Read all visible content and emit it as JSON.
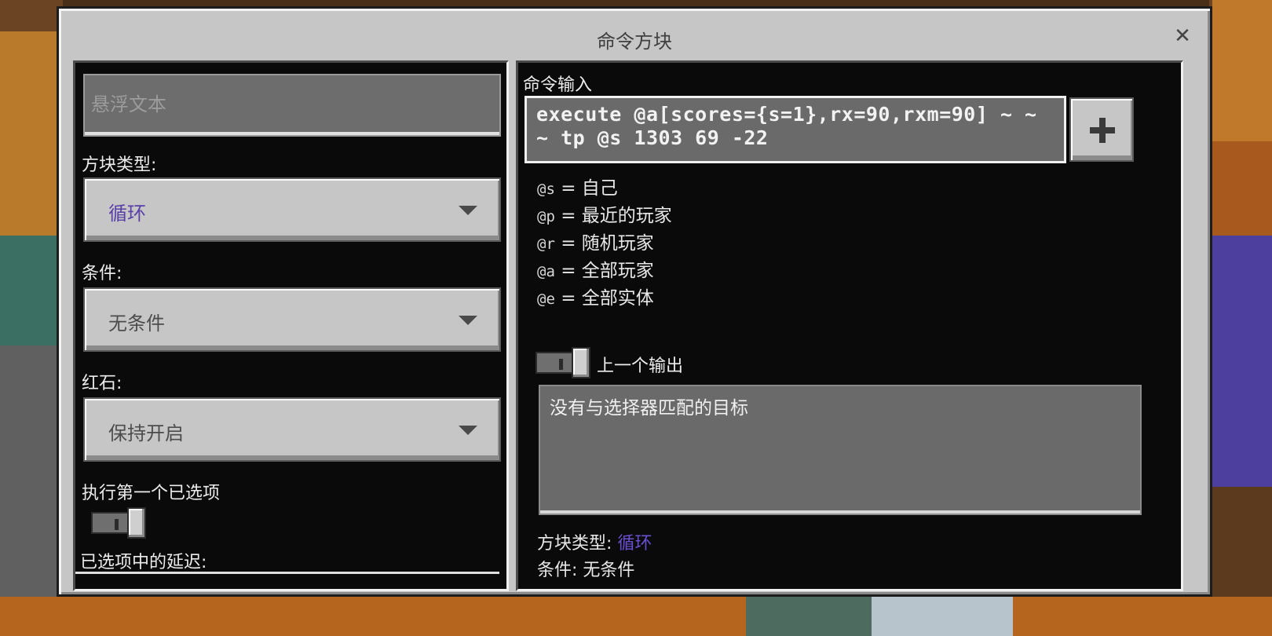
{
  "dialog": {
    "title": "命令方块",
    "close_icon": "close-icon"
  },
  "left": {
    "hover_text_placeholder": "悬浮文本",
    "block_type_label": "方块类型:",
    "block_type_value": "循环",
    "condition_label": "条件:",
    "condition_value": "无条件",
    "redstone_label": "红石:",
    "redstone_value": "保持开启",
    "execute_first_label": "执行第一个已选项",
    "delay_label": "已选项中的延迟:"
  },
  "right": {
    "command_input_label": "命令输入",
    "command_text": "execute @a[scores={s=1},rx=90,rxm=90] ~ ~ ~ tp @s 1303 69 -22",
    "plus_icon": "plus-icon",
    "selectors": [
      {
        "code": "@s",
        "desc": "= 自己"
      },
      {
        "code": "@p",
        "desc": "= 最近的玩家"
      },
      {
        "code": "@r",
        "desc": "= 随机玩家"
      },
      {
        "code": "@a",
        "desc": "= 全部玩家"
      },
      {
        "code": "@e",
        "desc": "= 全部实体"
      }
    ],
    "previous_output_label": "上一个输出",
    "output_text": "没有与选择器匹配的目标",
    "info_block_type_label": "方块类型:",
    "info_block_type_value": "循环",
    "info_condition_text": "条件: 无条件"
  },
  "colors": {
    "dialog_bg": "#c6c6c6",
    "panel_bg": "#0a0a0a",
    "accent_purple": "#5a3fa8"
  }
}
